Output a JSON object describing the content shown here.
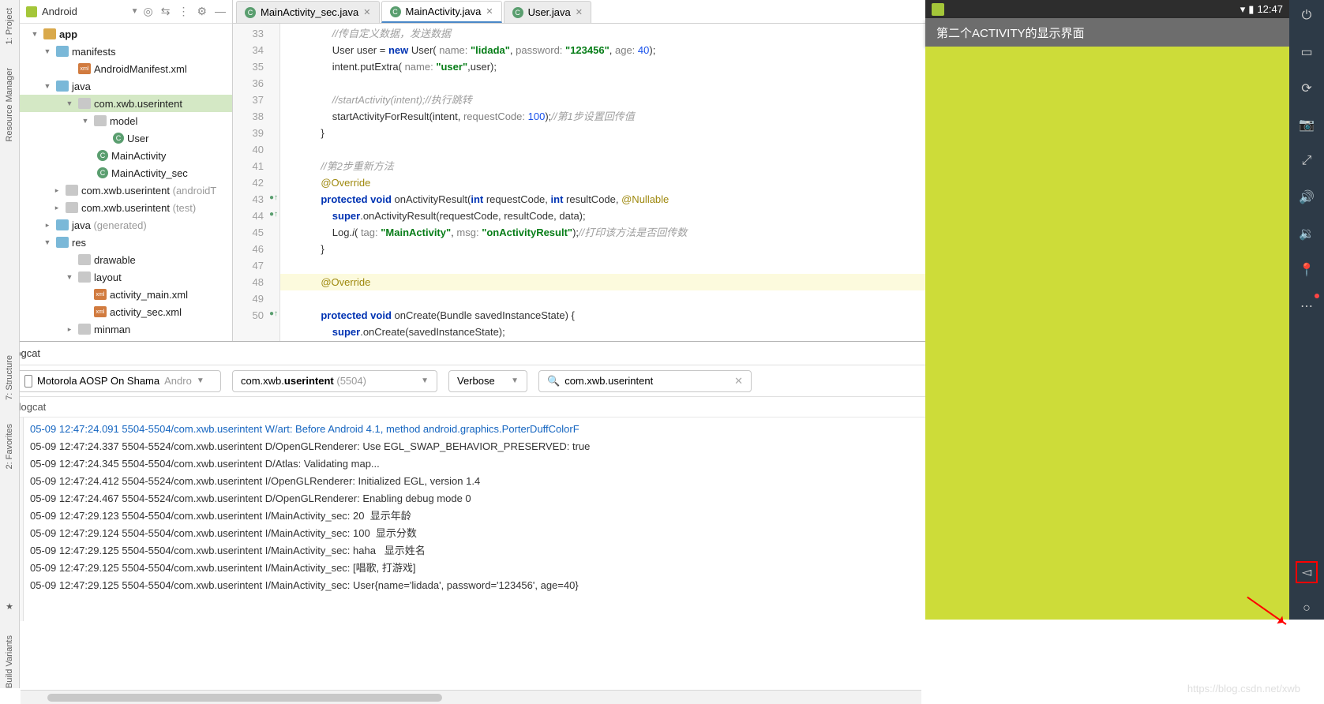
{
  "panel": {
    "title": "Android"
  },
  "tree": [
    {
      "indent": 12,
      "arrow": "▼",
      "icon": "folder",
      "label": "app",
      "bold": true
    },
    {
      "indent": 28,
      "arrow": "▼",
      "icon": "folder-blue",
      "label": "manifests"
    },
    {
      "indent": 56,
      "arrow": "",
      "icon": "xml",
      "label": "AndroidManifest.xml"
    },
    {
      "indent": 28,
      "arrow": "▼",
      "icon": "folder-blue",
      "label": "java"
    },
    {
      "indent": 56,
      "arrow": "▼",
      "icon": "folder-grey",
      "label": "com.xwb.userintent",
      "sel": true
    },
    {
      "indent": 76,
      "arrow": "▼",
      "icon": "folder-grey",
      "label": "model"
    },
    {
      "indent": 100,
      "arrow": "",
      "icon": "c",
      "label": "User"
    },
    {
      "indent": 80,
      "arrow": "",
      "icon": "c",
      "label": "MainActivity"
    },
    {
      "indent": 80,
      "arrow": "",
      "icon": "c",
      "label": "MainActivity_sec"
    },
    {
      "indent": 40,
      "arrow": "▸",
      "icon": "folder-grey",
      "label": "com.xwb.userintent ",
      "dim": "(androidT"
    },
    {
      "indent": 40,
      "arrow": "▸",
      "icon": "folder-grey",
      "label": "com.xwb.userintent ",
      "dim": "(test)"
    },
    {
      "indent": 28,
      "arrow": "▸",
      "icon": "folder-blue",
      "label": "java ",
      "dim": "(generated)"
    },
    {
      "indent": 28,
      "arrow": "▼",
      "icon": "folder-blue",
      "label": "res"
    },
    {
      "indent": 56,
      "arrow": "",
      "icon": "folder-grey",
      "label": "drawable"
    },
    {
      "indent": 56,
      "arrow": "▼",
      "icon": "folder-grey",
      "label": "layout"
    },
    {
      "indent": 76,
      "arrow": "",
      "icon": "xml",
      "label": "activity_main.xml"
    },
    {
      "indent": 76,
      "arrow": "",
      "icon": "xml",
      "label": "activity_sec.xml"
    },
    {
      "indent": 56,
      "arrow": "▸",
      "icon": "folder-grey",
      "label": "minman"
    }
  ],
  "tabs": [
    {
      "label": "MainActivity_sec.java",
      "active": false
    },
    {
      "label": "MainActivity.java",
      "active": true
    },
    {
      "label": "User.java",
      "active": false
    }
  ],
  "gutter_start": 33,
  "code_lines": [
    "                <span class='comment'>//传自定义数据，发送数据</span>",
    "                User user = <span class='kw'>new</span> User( <span class='param'>name:</span> <span class='str'>\"lidada\"</span>, <span class='param'>password:</span> <span class='str'>\"123456\"</span>, <span class='param'>age:</span> <span class='num'>40</span>);",
    "                intent.putExtra( <span class='param'>name:</span> <span class='str'>\"user\"</span>,user);",
    "",
    "                <span class='comment'>//startActivity(intent);//执行跳转</span>",
    "                startActivityForResult(intent, <span class='param'>requestCode:</span> <span class='num'>100</span>);<span class='comment'>//第1步设置回传值</span>",
    "            }",
    "",
    "            <span class='comment'>//第2步重新方法</span>",
    "            <span class='ann'>@Override</span>",
    "            <span class='kw'>protected void</span> onActivityResult(<span class='kw'>int</span> requestCode, <span class='kw'>int</span> resultCode, <span class='ann'>@Nullable</span>",
    "                <span class='kw'>super</span>.onActivityResult(requestCode, resultCode, data);",
    "                Log.<span style='font-style:italic'>i</span>( <span class='param'>tag:</span> <span class='str'>\"MainActivity\"</span>, <span class='param'>msg:</span> <span class='str'>\"onActivityResult\"</span>);<span class='comment'>//打印该方法是否回传数</span>",
    "            }",
    "",
    "<span class='hl-line'>            <span class='ann'>@Override</span></span>",
    "            <span class='kw'>protected void</span> onCreate(Bundle savedInstanceState) {",
    "                <span class='kw'>super</span>.onCreate(savedInstanceState);"
  ],
  "gutter_marks": {
    "43": "●↑",
    "44": "●↑",
    "49": "",
    "50": "●↑"
  },
  "logcat": {
    "title": "Logcat",
    "device": "Motorola AOSP On Shama",
    "device_dim": " Andro",
    "package_prefix": "com.xwb.",
    "package_bold": "userintent",
    "package_suffix": " (5504)",
    "level": "Verbose",
    "search": "com.xwb.userintent",
    "sub": "logcat",
    "lines": [
      {
        "cls": "blue",
        "t": "05-09 12:47:24.091 5504-5504/com.xwb.userintent W/art: Before Android 4.1, method android.graphics.PorterDuffColorF"
      },
      {
        "cls": "",
        "t": "05-09 12:47:24.337 5504-5524/com.xwb.userintent D/OpenGLRenderer: Use EGL_SWAP_BEHAVIOR_PRESERVED: true"
      },
      {
        "cls": "",
        "t": "05-09 12:47:24.345 5504-5504/com.xwb.userintent D/Atlas: Validating map..."
      },
      {
        "cls": "",
        "t": "05-09 12:47:24.412 5504-5524/com.xwb.userintent I/OpenGLRenderer: Initialized EGL, version 1.4"
      },
      {
        "cls": "",
        "t": "05-09 12:47:24.467 5504-5524/com.xwb.userintent D/OpenGLRenderer: Enabling debug mode 0"
      },
      {
        "cls": "",
        "t": "05-09 12:47:29.123 5504-5504/com.xwb.userintent I/MainActivity_sec: 20  显示年龄"
      },
      {
        "cls": "",
        "t": "05-09 12:47:29.124 5504-5504/com.xwb.userintent I/MainActivity_sec: 100  显示分数"
      },
      {
        "cls": "",
        "t": "05-09 12:47:29.125 5504-5504/com.xwb.userintent I/MainActivity_sec: haha   显示姓名"
      },
      {
        "cls": "",
        "t": "05-09 12:47:29.125 5504-5504/com.xwb.userintent I/MainActivity_sec: [唱歌, 打游戏]"
      },
      {
        "cls": "",
        "t": "05-09 12:47:29.125 5504-5504/com.xwb.userintent I/MainActivity_sec: User{name='lidada', password='123456', age=40}"
      }
    ]
  },
  "emulator": {
    "time": "12:47",
    "title": "第二个ACTIVITY的显示界面"
  },
  "watermark": "https://blog.csdn.net/xwb",
  "left_rail": [
    "1: Project",
    "Resource Manager"
  ],
  "left_strip": [
    "7: Structure",
    "2: Favorites",
    "Build Variants"
  ]
}
